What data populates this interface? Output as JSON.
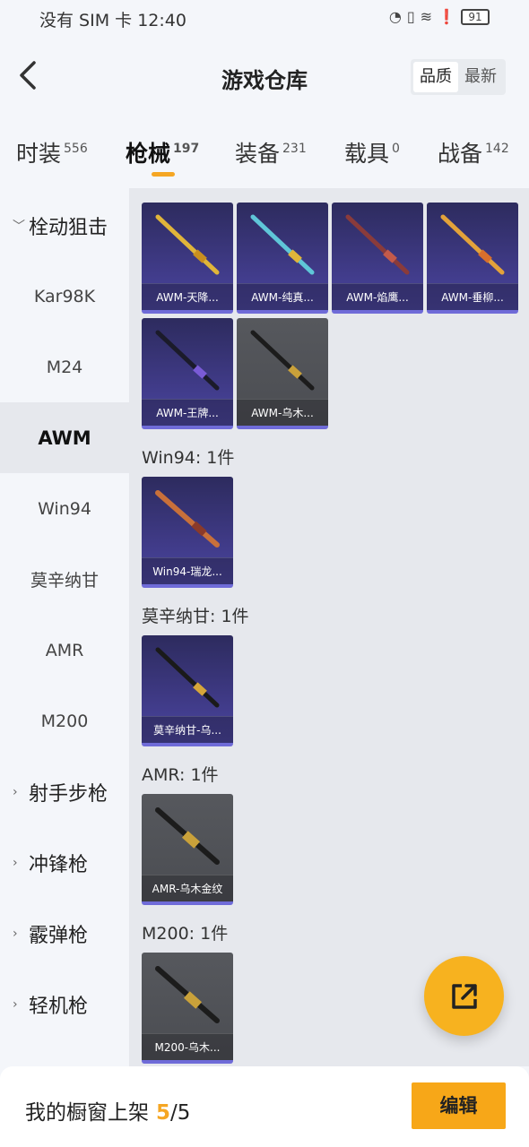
{
  "status_bar": {
    "carrier": "没有 SIM 卡",
    "time": "12:40",
    "battery": "91"
  },
  "header": {
    "title": "游戏仓库",
    "sort_quality": "品质",
    "sort_latest": "最新"
  },
  "tabs": [
    {
      "label": "时装",
      "count": "556"
    },
    {
      "label": "枪械",
      "count": "197"
    },
    {
      "label": "装备",
      "count": "231"
    },
    {
      "label": "载具",
      "count": "0"
    },
    {
      "label": "战备",
      "count": "142"
    }
  ],
  "sidebar": {
    "group1": "栓动狙击",
    "items": [
      "Kar98K",
      "M24",
      "AWM",
      "Win94",
      "莫辛纳甘",
      "AMR",
      "M200"
    ],
    "groups": [
      "射手步枪",
      "冲锋枪",
      "霰弹枪",
      "轻机枪"
    ]
  },
  "main": {
    "awm_cards": [
      "AWM-天降...",
      "AWM-纯真...",
      "AWM-焰鹰...",
      "AWM-垂柳...",
      "AWM-王牌...",
      "AWM-乌木..."
    ],
    "win94_label": "Win94: 1件",
    "win94_cards": [
      "Win94-瑞龙..."
    ],
    "mosin_label": "莫辛纳甘: 1件",
    "mosin_cards": [
      "莫辛纳甘-乌..."
    ],
    "amr_label": "AMR: 1件",
    "amr_cards": [
      "AMR-乌木金纹"
    ],
    "m200_label": "M200: 1件",
    "m200_cards": [
      "M200-乌木..."
    ]
  },
  "bottom_bar": {
    "label": "我的橱窗上架",
    "count_current": "5",
    "count_total": "/5",
    "edit_label": "编辑"
  },
  "colors": {
    "accent": "#f5a623",
    "card_purple": "#3f3a86",
    "card_gray": "#56585d"
  }
}
